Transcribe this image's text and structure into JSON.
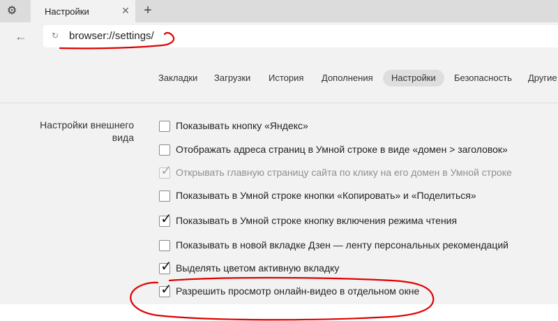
{
  "browser": {
    "tab_title": "Настройки",
    "url": "browser://settings/",
    "gear_icon": "gear-icon",
    "close_icon": "close-icon",
    "new_tab_icon": "plus-icon",
    "back_icon": "back-arrow-icon",
    "reload_icon": "reload-icon"
  },
  "nav": {
    "items": [
      "Закладки",
      "Загрузки",
      "История",
      "Дополнения",
      "Настройки",
      "Безопасность",
      "Другие"
    ],
    "active": "Настройки"
  },
  "appearance": {
    "label": "Настройки внешнего вида",
    "options": [
      {
        "label": "Показывать кнопку «Яндекс»",
        "checked": false,
        "disabled": false
      },
      {
        "label": "Отображать адреса страниц в Умной строке в виде «домен > заголовок»",
        "checked": false,
        "disabled": false
      },
      {
        "label": "Открывать главную страницу сайта по клику на его домен в Умной строке",
        "checked": true,
        "disabled": true
      },
      {
        "label": "Показывать в Умной строке кнопки «Копировать» и «Поделиться»",
        "checked": false,
        "disabled": false
      },
      {
        "label": "Показывать в Умной строке кнопку включения режима чтения",
        "checked": true,
        "disabled": false
      },
      {
        "label": "Показывать в новой вкладке Дзен — ленту персональных рекомендаций",
        "checked": false,
        "disabled": false
      },
      {
        "label": "Выделять цветом активную вкладку",
        "checked": true,
        "disabled": false
      },
      {
        "label": "Разрешить просмотр онлайн-видео в отдельном окне",
        "checked": true,
        "disabled": false
      }
    ]
  },
  "colors": {
    "annotation": "#e00000",
    "check": "#111111",
    "disabled_text": "#8f8f8f"
  }
}
